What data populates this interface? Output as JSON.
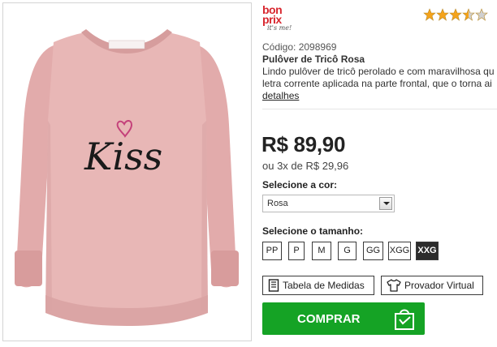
{
  "brand": {
    "logo_text": "bon prix",
    "tagline": "it's me!"
  },
  "rating": {
    "value": 3.5,
    "max": 5,
    "icon": "star-icon",
    "color": "#f5a31a"
  },
  "product": {
    "image_alt": "Pulôver de Tricô Rosa",
    "image_print": "Kiss",
    "code_label": "Código: 2098969",
    "name": "Pulôver de Tricô Rosa",
    "description_line1": "Lindo pulôver de tricô perolado e com maravilhosa qu",
    "description_line2": "letra corrente aplicada na parte frontal, que o torna ai",
    "details_link": "detalhes",
    "price": "R$ 89,90",
    "installments": "ou 3x de R$ 29,96"
  },
  "color_selector": {
    "label": "Selecione a cor:",
    "selected": "Rosa"
  },
  "size_selector": {
    "label": "Selecione o tamanho:",
    "sizes": [
      {
        "label": "PP",
        "selected": false
      },
      {
        "label": "P",
        "selected": false
      },
      {
        "label": "M",
        "selected": false
      },
      {
        "label": "G",
        "selected": false
      },
      {
        "label": "GG",
        "selected": false
      },
      {
        "label": "XGG",
        "selected": false
      },
      {
        "label": "XXG",
        "selected": true
      }
    ]
  },
  "tools": {
    "size_chart": "Tabela de Medidas",
    "size_chart_icon": "ruler-icon",
    "virtual_fitting": "Provador Virtual",
    "virtual_fitting_icon": "shirt-icon"
  },
  "buy_button": {
    "label": "COMPRAR",
    "icon": "shopping-bag-icon",
    "color": "#15a325"
  },
  "colors": {
    "sweater": "#e8b7b6",
    "sweater_shade": "#d9a3a3",
    "brand_red": "#d8262e"
  }
}
